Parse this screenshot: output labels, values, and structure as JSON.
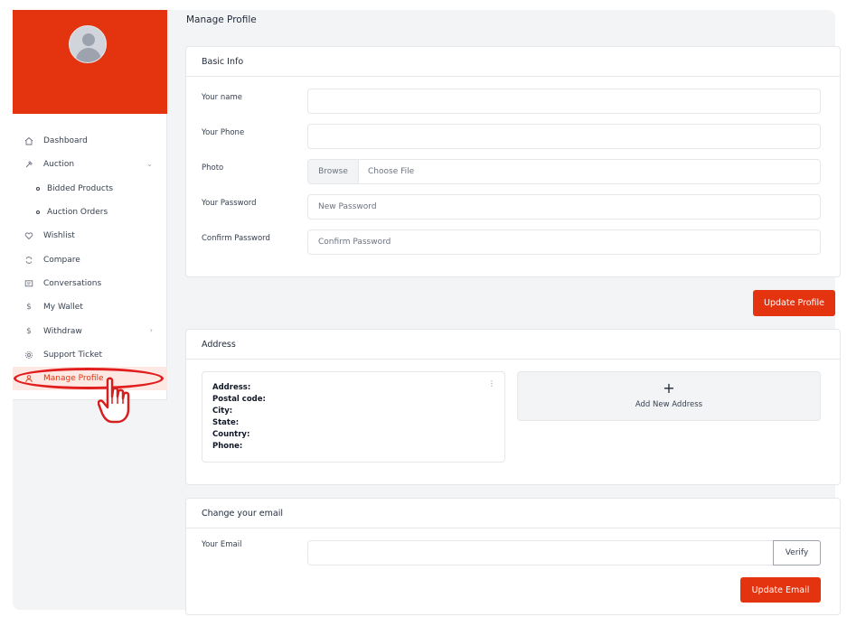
{
  "page": {
    "title": "Manage Profile"
  },
  "sidebar": {
    "items": [
      {
        "label": "Dashboard",
        "icon": "home-icon"
      },
      {
        "label": "Auction",
        "icon": "gavel-icon",
        "has_chevron": "down"
      },
      {
        "label": "Bidded Products",
        "sub": true
      },
      {
        "label": "Auction Orders",
        "sub": true
      },
      {
        "label": "Wishlist",
        "icon": "heart-icon"
      },
      {
        "label": "Compare",
        "icon": "refresh-icon"
      },
      {
        "label": "Conversations",
        "icon": "chat-icon"
      },
      {
        "label": "My Wallet",
        "icon": "dollar-icon"
      },
      {
        "label": "Withdraw",
        "icon": "dollar-icon",
        "has_chevron": "right"
      },
      {
        "label": "Support Ticket",
        "icon": "gear-icon"
      },
      {
        "label": "Manage Profile",
        "icon": "user-icon",
        "active": true
      }
    ]
  },
  "basic_info": {
    "title": "Basic Info",
    "name_label": "Your name",
    "phone_label": "Your Phone",
    "photo_label": "Photo",
    "browse_label": "Browse",
    "choose_file": "Choose File",
    "password_label": "Your Password",
    "password_placeholder": "New Password",
    "confirm_label": "Confirm Password",
    "confirm_placeholder": "Confirm Password",
    "update_button": "Update Profile"
  },
  "address": {
    "title": "Address",
    "fields": [
      "Address:",
      "Postal code:",
      "City:",
      "State:",
      "Country:",
      "Phone:"
    ],
    "kebab": "⋮",
    "add_plus": "+",
    "add_label": "Add New Address"
  },
  "email": {
    "title": "Change your email",
    "email_label": "Your Email",
    "verify_button": "Verify",
    "update_button": "Update Email"
  },
  "colors": {
    "accent": "#e3330f",
    "annotation": "#e11d1d"
  }
}
